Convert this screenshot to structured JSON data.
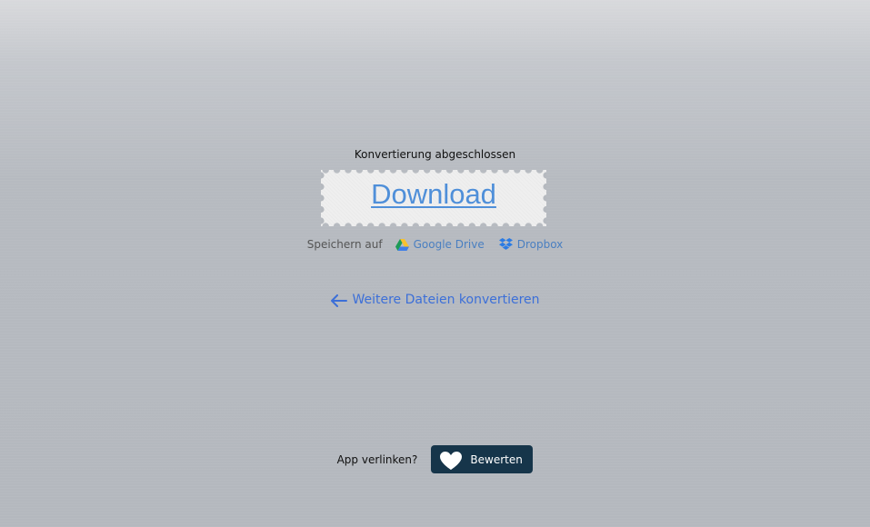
{
  "conversion": {
    "status_text": "Konvertierung abgeschlossen",
    "download_label": "Download",
    "download_color": "#4f8fd9"
  },
  "save": {
    "label": "Speichern auf",
    "services": [
      {
        "name": "Google Drive",
        "icon": "google-drive-icon"
      },
      {
        "name": "Dropbox",
        "icon": "dropbox-icon"
      }
    ],
    "link_color": "#4a7fc1"
  },
  "navigation": {
    "back_label": "Weitere Dateien konvertieren",
    "back_icon": "arrow-left-icon",
    "link_color": "#3c6fd8"
  },
  "rating": {
    "question": "App verlinken?",
    "button_label": "Bewerten",
    "button_icon": "heart-icon",
    "button_color": "#16354a"
  }
}
